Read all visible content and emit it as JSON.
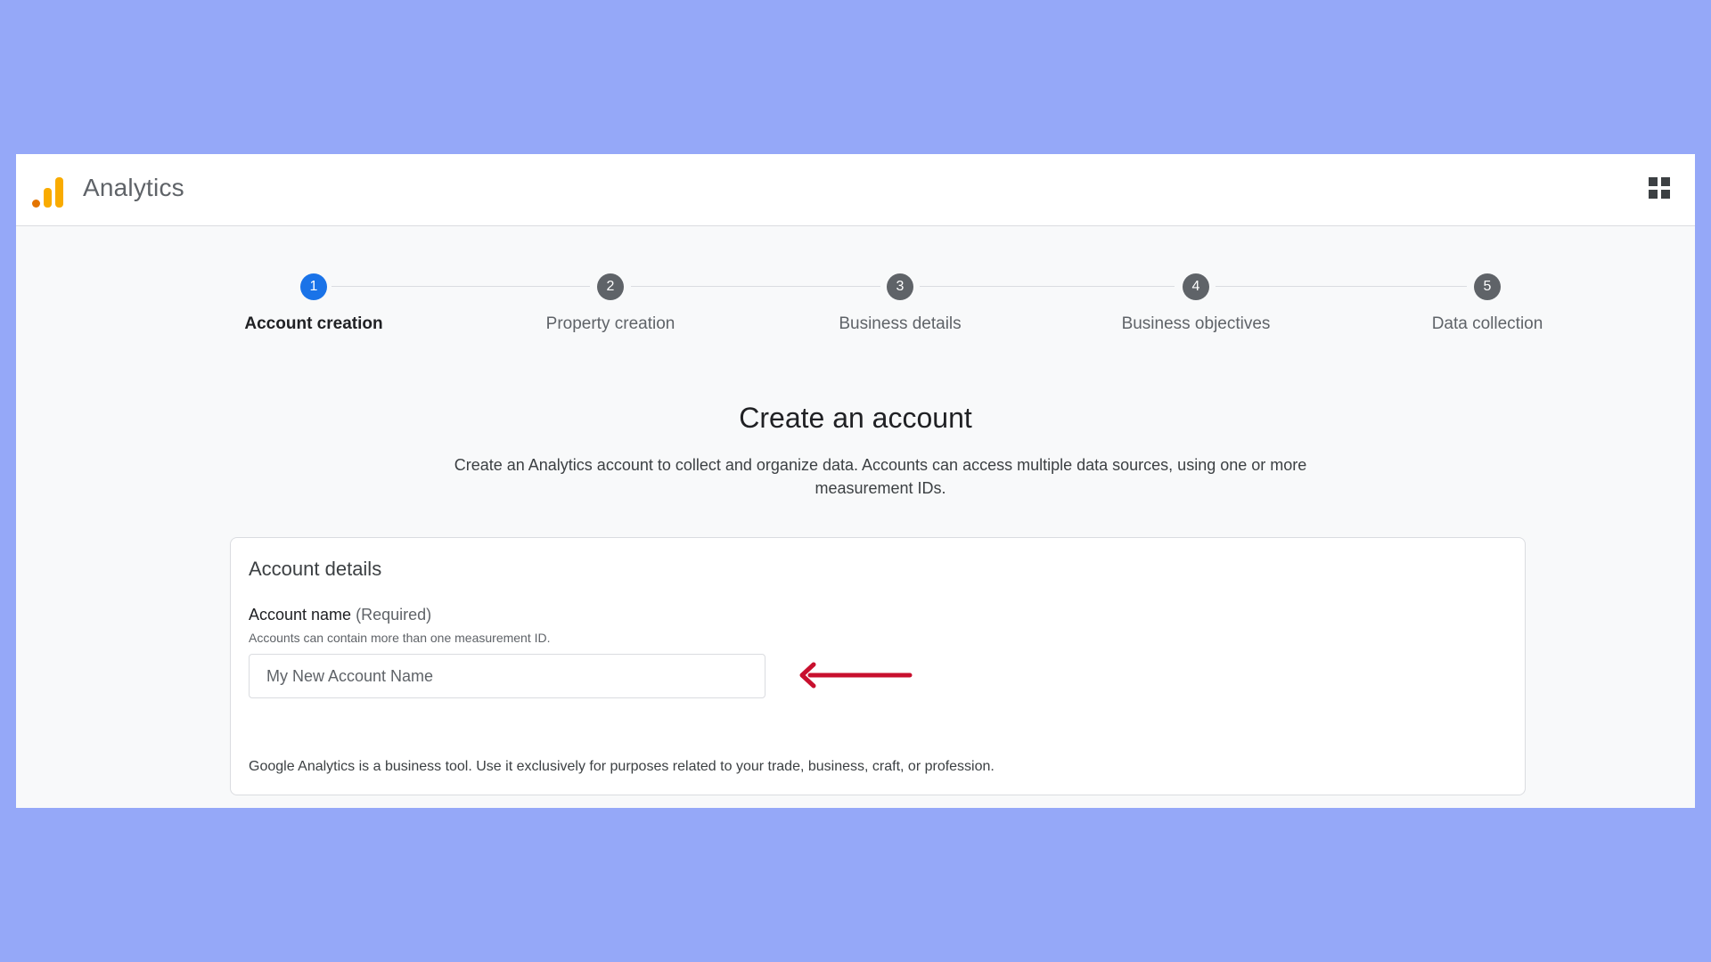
{
  "app": {
    "title": "Analytics"
  },
  "steps": [
    {
      "number": "1",
      "label": "Account creation",
      "state": "active"
    },
    {
      "number": "2",
      "label": "Property creation",
      "state": "pending"
    },
    {
      "number": "3",
      "label": "Business details",
      "state": "pending"
    },
    {
      "number": "4",
      "label": "Business objectives",
      "state": "pending"
    },
    {
      "number": "5",
      "label": "Data collection",
      "state": "pending"
    }
  ],
  "main": {
    "heading": "Create an account",
    "description": "Create an Analytics account to collect and organize data. Accounts can access multiple data sources, using one or more measurement IDs."
  },
  "account_details": {
    "title": "Account details",
    "field_label": "Account name",
    "field_required": "(Required)",
    "field_help": "Accounts can contain more than one measurement ID.",
    "field_placeholder": "My New Account Name",
    "field_value": "",
    "footer_note": "Google Analytics is a business tool. Use it exclusively for purposes related to your trade, business, craft, or profession."
  },
  "icons": {
    "logo": "analytics-logo-icon",
    "apps": "apps-grid-icon",
    "annotation": "left-arrow-annotation"
  },
  "colors": {
    "background": "#95a8f8",
    "active_step": "#1a73e8",
    "pending_step": "#5f6368",
    "arrow": "#c8102e",
    "logo_dark": "#e37400",
    "logo_light": "#f9ab00"
  }
}
